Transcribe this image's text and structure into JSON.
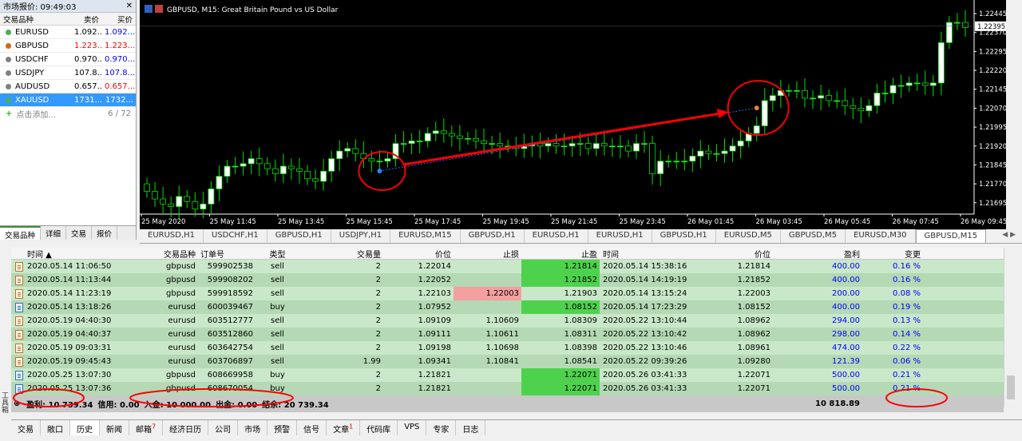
{
  "market_watch": {
    "title": "市场报价: 09:49:03",
    "col_symbol": "交易品种",
    "col_bid": "卖价",
    "col_ask": "买价",
    "rows": [
      {
        "symbol": "EURUSD",
        "bid": "1.092...",
        "ask": "1.092...",
        "dot": "#4caf50",
        "bid_color": "#000000",
        "ask_color": "#0000ff"
      },
      {
        "symbol": "GBPUSD",
        "bid": "1.223...",
        "ask": "1.223...",
        "dot": "#e06010",
        "bid_color": "#ff0000",
        "ask_color": "#ff0000"
      },
      {
        "symbol": "USDCHF",
        "bid": "0.970...",
        "ask": "0.970...",
        "dot": "#808080",
        "bid_color": "#000000",
        "ask_color": "#0000ff"
      },
      {
        "symbol": "USDJPY",
        "bid": "107.8...",
        "ask": "107.8...",
        "dot": "#808080",
        "bid_color": "#000000",
        "ask_color": "#0000ff"
      },
      {
        "symbol": "AUDUSD",
        "bid": "0.657...",
        "ask": "0.657...",
        "dot": "#808080",
        "bid_color": "#000000",
        "ask_color": "#ff0000"
      },
      {
        "symbol": "XAUUSD",
        "bid": "1731...",
        "ask": "1732...",
        "dot": "#4caf50",
        "bid_color": "#ffffff",
        "ask_color": "#ffffff",
        "selected": true
      }
    ],
    "add_label": "点击添加...",
    "count": "6 / 72",
    "tabs": [
      "交易品种",
      "详细",
      "交易",
      "报价"
    ]
  },
  "chart_data": {
    "type": "candlestick",
    "title": "GBPUSD, M15:  Great Britain Pound vs US Dollar",
    "current_price": "1.22395",
    "y_ticks": [
      "1.22445",
      "1.22370",
      "1.22295",
      "1.22220",
      "1.22145",
      "1.22070",
      "1.21995",
      "1.21920",
      "1.21845",
      "1.21770",
      "1.21695"
    ],
    "x_ticks": [
      "25 May 2020",
      "25 May 11:45",
      "25 May 13:45",
      "25 May 15:45",
      "25 May 17:45",
      "25 May 19:45",
      "25 May 21:45",
      "25 May 23:45",
      "26 May 01:45",
      "26 May 03:45",
      "26 May 05:45",
      "26 May 07:45",
      "26 May 09:45"
    ],
    "ylim": [
      1.2165,
      1.2248
    ],
    "close": [
      1.2174,
      1.2171,
      1.2169,
      1.2168,
      1.2172,
      1.217,
      1.2167,
      1.2169,
      1.2175,
      1.218,
      1.2184,
      1.2184,
      1.2185,
      1.2187,
      1.2185,
      1.2183,
      1.2181,
      1.2184,
      1.2183,
      1.2182,
      1.2179,
      1.2178,
      1.2182,
      1.2187,
      1.219,
      1.2191,
      1.2189,
      1.2187,
      1.2186,
      1.2186,
      1.2187,
      1.2193,
      1.2193,
      1.2194,
      1.2194,
      1.2197,
      1.2198,
      1.2197,
      1.2196,
      1.2195,
      1.2195,
      1.2194,
      1.2193,
      1.2193,
      1.2192,
      1.2192,
      1.2191,
      1.2192,
      1.2193,
      1.2192,
      1.2193,
      1.2192,
      1.2192,
      1.2193,
      1.2193,
      1.2191,
      1.2193,
      1.2192,
      1.2192,
      1.2192,
      1.219,
      1.2193,
      1.2193,
      1.2181,
      1.2186,
      1.2186,
      1.2186,
      1.2186,
      1.2188,
      1.219,
      1.2189,
      1.2189,
      1.219,
      1.2192,
      1.2194,
      1.2197,
      1.22,
      1.221,
      1.2212,
      1.2214,
      1.2214,
      1.2214,
      1.2211,
      1.2211,
      1.2212,
      1.221,
      1.221,
      1.2208,
      1.2207,
      1.2206,
      1.2208,
      1.2213,
      1.2213,
      1.2216,
      1.2216,
      1.2217,
      1.2217,
      1.2216,
      1.2217,
      1.2233,
      1.2241,
      1.2241,
      1.2239
    ]
  },
  "chart_tabs": [
    "EURUSD,H1",
    "USDCHF,H1",
    "GBPUSD,H1",
    "USDJPY,H1",
    "EURUSD,M15",
    "GBPUSD,H1",
    "EURUSD,H1",
    "EURUSD,H1",
    "GBPUSD,H1",
    "EURUSD,M5",
    "GBPUSD,M5",
    "EURUSD,M30",
    "GBPUSD,M15"
  ],
  "history": {
    "columns": [
      "时间",
      "交易品种",
      "订单号",
      "类型",
      "交易量",
      "价位",
      "止损",
      "止盈",
      "时间",
      "价位",
      "盈利",
      "变更"
    ],
    "rows": [
      {
        "time": "2020.05.14 11:06:50",
        "symbol": "gbpusd",
        "order": "599902538",
        "type": "sell",
        "volume": "2",
        "price": "1.22014",
        "sl": "",
        "tp": "1.21814",
        "close_time": "2020.05.14 15:38:16",
        "close_price": "1.21814",
        "profit": "400.00",
        "change": "0.16 %",
        "icon": "sell",
        "tp_hit": true
      },
      {
        "time": "2020.05.14 11:13:44",
        "symbol": "gbpusd",
        "order": "599908202",
        "type": "sell",
        "volume": "2",
        "price": "1.22052",
        "sl": "",
        "tp": "1.21852",
        "close_time": "2020.05.14 14:19:19",
        "close_price": "1.21852",
        "profit": "400.00",
        "change": "0.16 %",
        "icon": "sell",
        "tp_hit": true
      },
      {
        "time": "2020.05.14 11:23:19",
        "symbol": "gbpusd",
        "order": "599918592",
        "type": "sell",
        "volume": "2",
        "price": "1.22103",
        "sl": "1.22003",
        "tp": "1.21903",
        "close_time": "2020.05.14 13:15:24",
        "close_price": "1.22003",
        "profit": "200.00",
        "change": "0.08 %",
        "icon": "sell",
        "sl_hit": true
      },
      {
        "time": "2020.05.14 13:18:26",
        "symbol": "eurusd",
        "order": "600039467",
        "type": "buy",
        "volume": "2",
        "price": "1.07952",
        "sl": "",
        "tp": "1.08152",
        "close_time": "2020.05.14 17:23:29",
        "close_price": "1.08152",
        "profit": "400.00",
        "change": "0.19 %",
        "icon": "buy",
        "tp_hit": true
      },
      {
        "time": "2020.05.19 04:40:30",
        "symbol": "eurusd",
        "order": "603512777",
        "type": "sell",
        "volume": "2",
        "price": "1.09109",
        "sl": "1.10609",
        "tp": "1.08309",
        "close_time": "2020.05.22 13:10:44",
        "close_price": "1.08962",
        "profit": "294.00",
        "change": "0.13 %",
        "icon": "sell"
      },
      {
        "time": "2020.05.19 04:40:37",
        "symbol": "eurusd",
        "order": "603512860",
        "type": "sell",
        "volume": "2",
        "price": "1.09111",
        "sl": "1.10611",
        "tp": "1.08311",
        "close_time": "2020.05.22 13:10:42",
        "close_price": "1.08962",
        "profit": "298.00",
        "change": "0.14 %",
        "icon": "sell"
      },
      {
        "time": "2020.05.19 09:03:31",
        "symbol": "eurusd",
        "order": "603642754",
        "type": "sell",
        "volume": "2",
        "price": "1.09198",
        "sl": "1.10698",
        "tp": "1.08398",
        "close_time": "2020.05.22 13:10:46",
        "close_price": "1.08961",
        "profit": "474.00",
        "change": "0.22 %",
        "icon": "sell"
      },
      {
        "time": "2020.05.19 09:45:43",
        "symbol": "eurusd",
        "order": "603706897",
        "type": "sell",
        "volume": "1.99",
        "price": "1.09341",
        "sl": "1.10841",
        "tp": "1.08541",
        "close_time": "2020.05.22 09:39:26",
        "close_price": "1.09280",
        "profit": "121.39",
        "change": "0.06 %",
        "icon": "sell"
      },
      {
        "time": "2020.05.25 13:07:30",
        "symbol": "gbpusd",
        "order": "608669958",
        "type": "buy",
        "volume": "2",
        "price": "1.21821",
        "sl": "",
        "tp": "1.22071",
        "close_time": "2020.05.26 03:41:33",
        "close_price": "1.22071",
        "profit": "500.00",
        "change": "0.21 %",
        "icon": "buy",
        "tp_hit": true
      },
      {
        "time": "2020.05.25 13:07:36",
        "symbol": "gbpusd",
        "order": "608670054",
        "type": "buy",
        "volume": "2",
        "price": "1.21821",
        "sl": "",
        "tp": "1.22071",
        "close_time": "2020.05.26 03:41:33",
        "close_price": "1.22071",
        "profit": "500.00",
        "change": "0.21 %",
        "icon": "buy",
        "tp_hit": true
      }
    ],
    "footer": {
      "profit": "盈利: 10 739.34",
      "credit": "信用: 0.00",
      "deposit": "入金: 10 000.00",
      "withdraw": "出金: 0.00",
      "balance": "结余: 20 739.34",
      "total": "10 818.89"
    }
  },
  "toolbox_label": "工具箱",
  "bottom_tabs": [
    {
      "label": "交易"
    },
    {
      "label": "敞口"
    },
    {
      "label": "历史",
      "active": true
    },
    {
      "label": "新闻"
    },
    {
      "label": "邮箱",
      "badge": "7"
    },
    {
      "label": "经济日历"
    },
    {
      "label": "公司"
    },
    {
      "label": "市场"
    },
    {
      "label": "预警"
    },
    {
      "label": "信号"
    },
    {
      "label": "文章",
      "badge": "1"
    },
    {
      "label": "代码库"
    },
    {
      "label": "VPS"
    },
    {
      "label": "专家"
    },
    {
      "label": "日志"
    }
  ],
  "colors": {
    "bull": "#ffffff",
    "bear": "#000000",
    "wick": "#00e000",
    "highlight": "#ff0000"
  }
}
